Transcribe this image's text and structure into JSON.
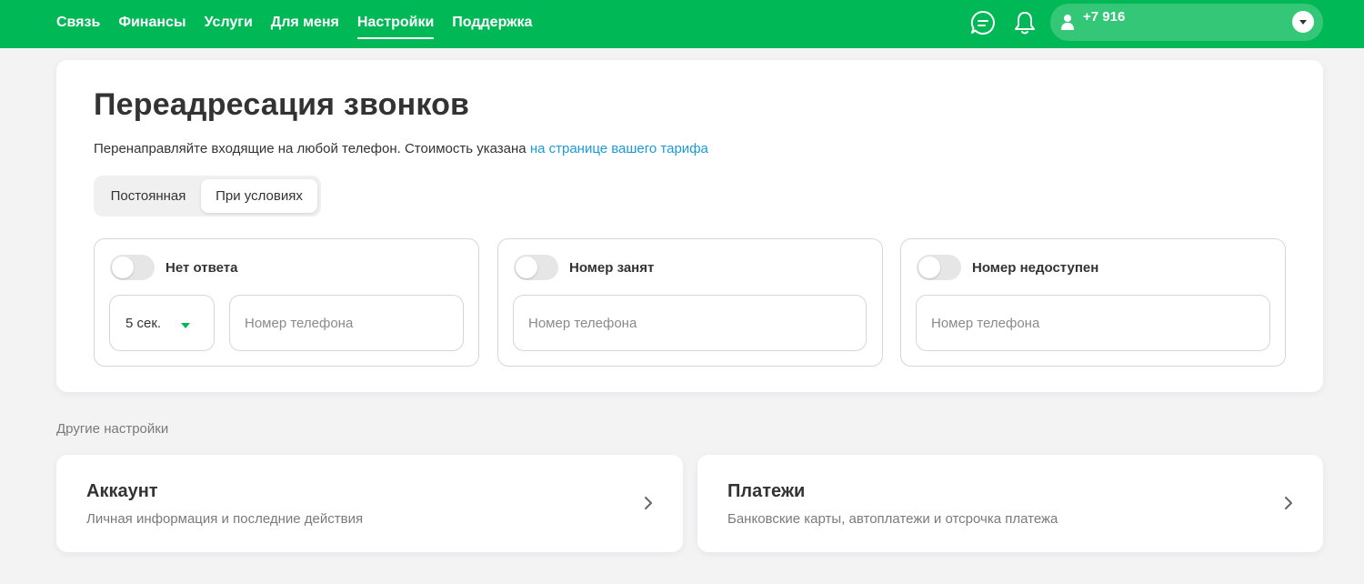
{
  "header": {
    "nav": [
      {
        "label": "Связь",
        "active": false
      },
      {
        "label": "Финансы",
        "active": false
      },
      {
        "label": "Услуги",
        "active": false
      },
      {
        "label": "Для меня",
        "active": false
      },
      {
        "label": "Настройки",
        "active": true
      },
      {
        "label": "Поддержка",
        "active": false
      }
    ],
    "chat_icon": "chat-bubble-icon",
    "bell_icon": "bell-icon",
    "account": {
      "phone": "+7 916",
      "user_icon": "user-icon",
      "dropdown_icon": "chevron-down-icon"
    }
  },
  "forwarding": {
    "title": "Переадресация звонков",
    "subtitle_text": "Перенаправляйте входящие на любой телефон. Стоимость указана ",
    "subtitle_link": "на странице вашего тарифа",
    "tabs": [
      {
        "label": "Постоянная",
        "selected": false
      },
      {
        "label": "При условиях",
        "selected": true
      }
    ],
    "options": [
      {
        "label": "Нет ответа",
        "enabled": false,
        "delay": "5 сек.",
        "placeholder": "Номер телефона"
      },
      {
        "label": "Номер занят",
        "enabled": false,
        "placeholder": "Номер телефона"
      },
      {
        "label": "Номер недоступен",
        "enabled": false,
        "placeholder": "Номер телефона"
      }
    ]
  },
  "other": {
    "section_label": "Другие настройки",
    "cards": [
      {
        "title": "Аккаунт",
        "desc": "Личная информация и последние действия"
      },
      {
        "title": "Платежи",
        "desc": "Банковские карты, автоплатежи и отсрочка платежа"
      }
    ]
  },
  "colors": {
    "brand": "#00b956",
    "link": "#1a9bd7"
  }
}
